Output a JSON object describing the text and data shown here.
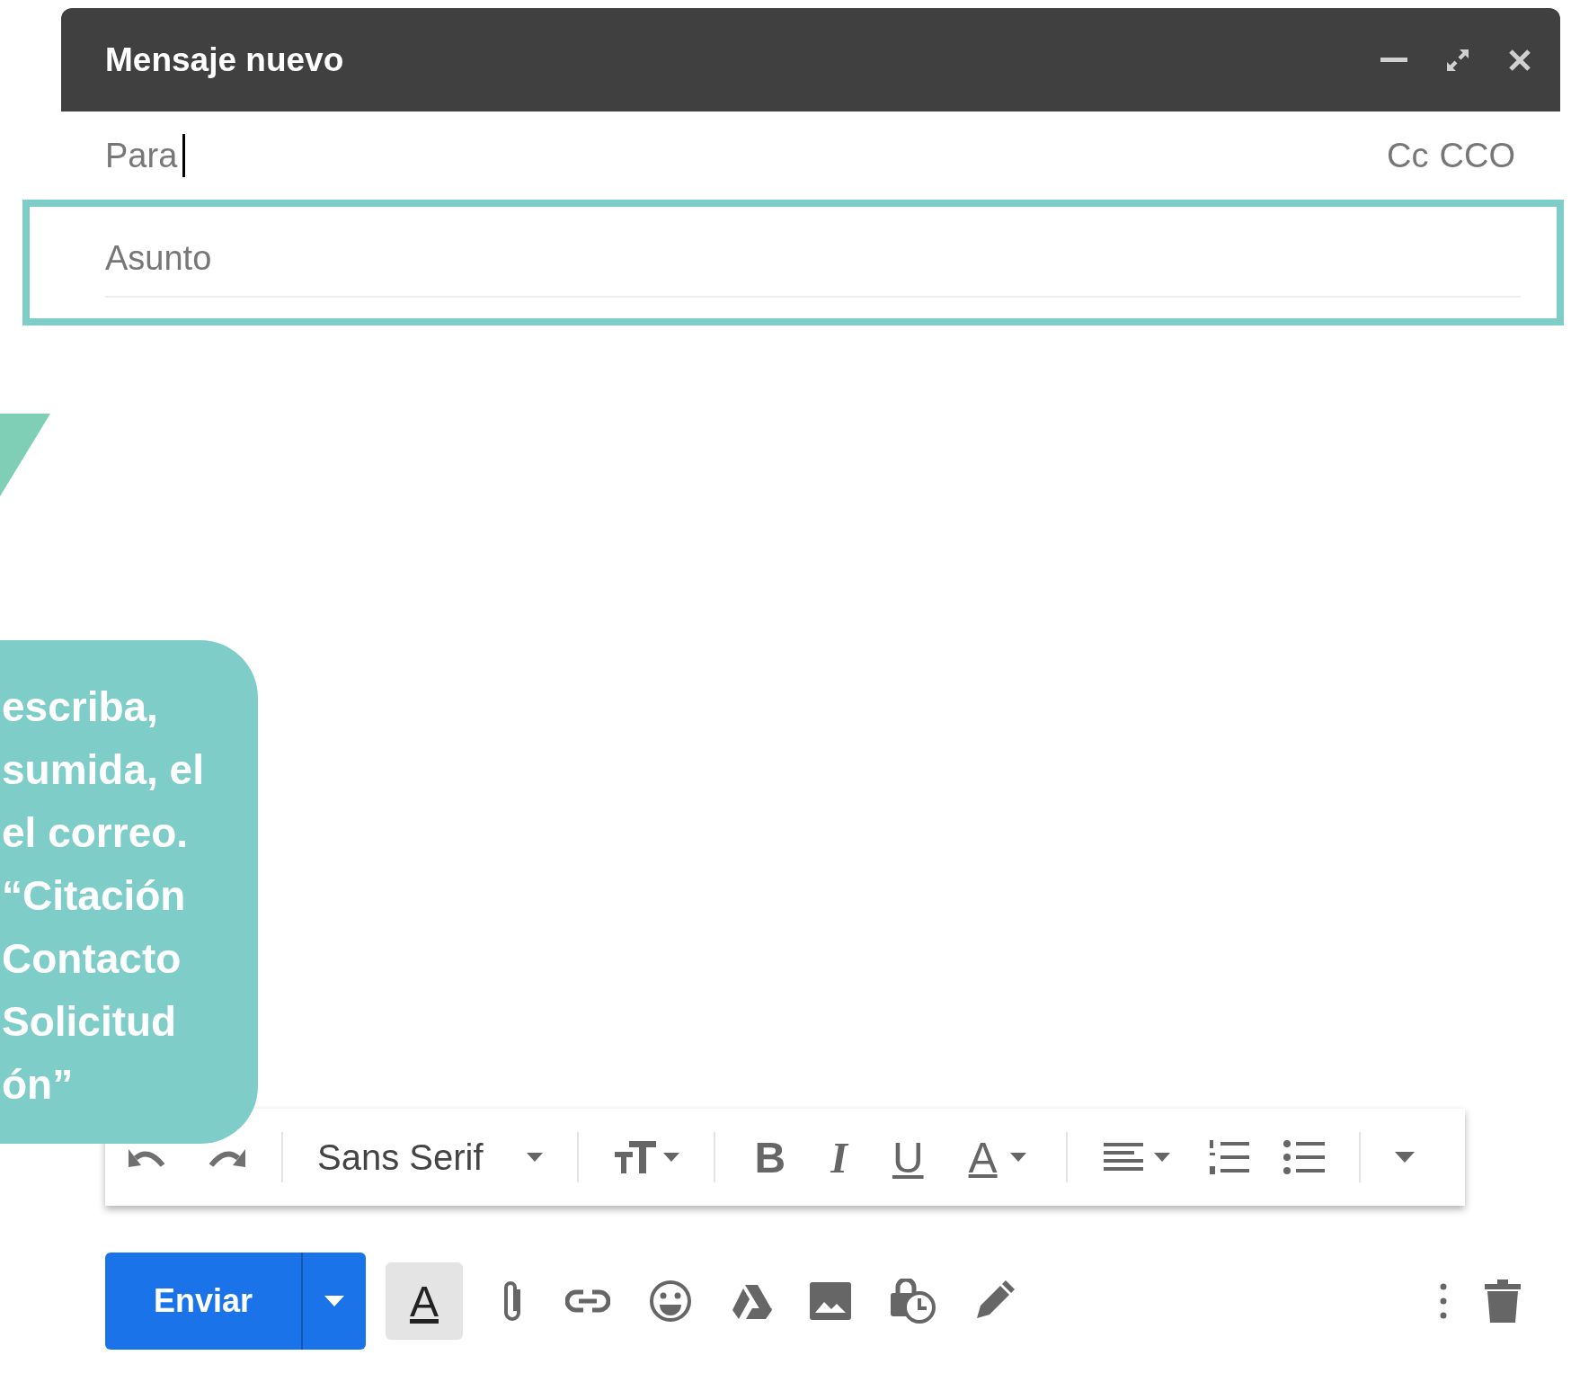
{
  "window": {
    "title": "Mensaje nuevo"
  },
  "recipients": {
    "label": "Para",
    "focused": true,
    "links": [
      "Cc",
      "CCO"
    ]
  },
  "subject": {
    "placeholder": "Asunto",
    "highlighted": true
  },
  "callout": {
    "lines": [
      "escriba,",
      "sumida, el",
      "el correo.",
      "“Citación",
      "Contacto",
      "Solicitud",
      "ón”"
    ]
  },
  "format_toolbar": {
    "font": "Sans Serif",
    "bold": "B",
    "italic": "I",
    "underline": "U",
    "text_color": "A"
  },
  "send_button": {
    "label": "Enviar"
  },
  "formatting_button": {
    "label": "A",
    "selected": true
  }
}
